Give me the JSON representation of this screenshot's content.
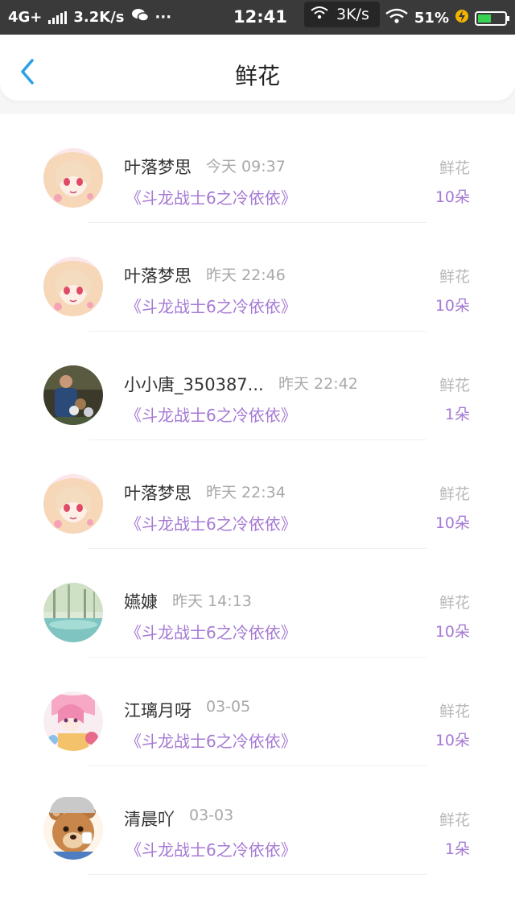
{
  "status_bar": {
    "network": "4G+",
    "speed_left": "3.2K/s",
    "more": "···",
    "time": "12:41",
    "speed_popup": "3K/s",
    "battery": "51%",
    "battery_level": 0.51
  },
  "header": {
    "title": "鲜花"
  },
  "items": [
    {
      "name": "叶落梦思",
      "time": "今天 09:37",
      "book": "《斗龙战士6之冷依依》",
      "gift": "鲜花",
      "count": "10朵",
      "avatar": "anime-girl-pink"
    },
    {
      "name": "叶落梦思",
      "time": "昨天 22:46",
      "book": "《斗龙战士6之冷依依》",
      "gift": "鲜花",
      "count": "10朵",
      "avatar": "anime-girl-pink"
    },
    {
      "name": "小小唐_350387...",
      "time": "昨天 22:42",
      "book": "《斗龙战士6之冷依依》",
      "gift": "鲜花",
      "count": "1朵",
      "avatar": "photo-person"
    },
    {
      "name": "叶落梦思",
      "time": "昨天 22:34",
      "book": "《斗龙战士6之冷依依》",
      "gift": "鲜花",
      "count": "10朵",
      "avatar": "anime-girl-pink"
    },
    {
      "name": "嬿嫝",
      "time": "昨天 14:13",
      "book": "《斗龙战士6之冷依依》",
      "gift": "鲜花",
      "count": "10朵",
      "avatar": "forest-scene"
    },
    {
      "name": "江璃月呀",
      "time": "03-05",
      "book": "《斗龙战士6之冷依依》",
      "gift": "鲜花",
      "count": "10朵",
      "avatar": "anime-girl-colorful"
    },
    {
      "name": "清晨吖",
      "time": "03-03",
      "book": "《斗龙战士6之冷依依》",
      "gift": "鲜花",
      "count": "1朵",
      "avatar": "cartoon-bear"
    }
  ],
  "colors": {
    "accent": "#a57ad4",
    "back": "#2aa0e8",
    "statusbar": "#3a3a3a"
  }
}
